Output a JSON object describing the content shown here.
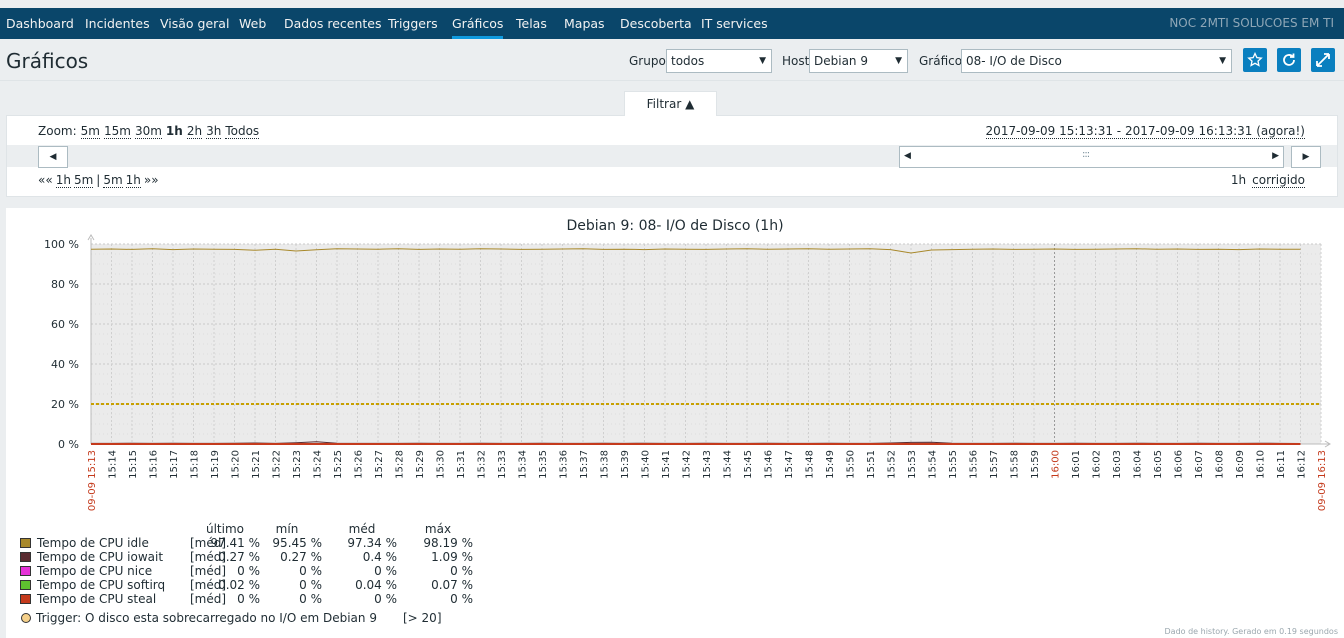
{
  "nav": {
    "items": [
      {
        "label": "Dashboard",
        "active": false
      },
      {
        "label": "Incidentes",
        "active": false
      },
      {
        "label": "Visão geral",
        "active": false
      },
      {
        "label": "Web",
        "active": false
      },
      {
        "label": "Dados recentes",
        "active": false
      },
      {
        "label": "Triggers",
        "active": false
      },
      {
        "label": "Gráficos",
        "active": true
      },
      {
        "label": "Telas",
        "active": false
      },
      {
        "label": "Mapas",
        "active": false
      },
      {
        "label": "Descoberta",
        "active": false
      },
      {
        "label": "IT services",
        "active": false
      }
    ],
    "brand": "NOC 2MTI SOLUCOES EM TI"
  },
  "header": {
    "title": "Gráficos",
    "group_label": "Grupo",
    "group_value": "todos",
    "host_label": "Host",
    "host_value": "Debian 9",
    "graph_label": "Gráfico",
    "graph_value": "08- I/O de Disco",
    "icons": [
      "star-icon",
      "refresh-icon",
      "fullscreen-icon"
    ]
  },
  "filter": {
    "tab_label": "Filtrar ▲",
    "zoom_label": "Zoom:",
    "zoom_options": [
      "5m",
      "15m",
      "30m",
      "1h",
      "2h",
      "3h",
      "Todos"
    ],
    "zoom_selected": "1h",
    "period": "2017-09-09 15:13:31 - 2017-09-09 16:13:31 (agora!)",
    "nav_back_all": "««",
    "nav_back": [
      "1h",
      "5m"
    ],
    "nav_separator": "|",
    "nav_fwd": [
      "5m",
      "1h"
    ],
    "nav_fwd_all": "»»",
    "period_length": "1h",
    "fixed_label": "corrigido",
    "slider_grip": ":::"
  },
  "chart_data": {
    "type": "line",
    "title": "Debian 9: 08- I/O de Disco (1h)",
    "y_ticks": [
      "100 %",
      "80 %",
      "60 %",
      "40 %",
      "20 %",
      "0 %"
    ],
    "ylim": [
      0,
      100
    ],
    "x_start_label": "09-09 15:13",
    "x_end_label": "09-09 16:13",
    "x_ticks": [
      "15:14",
      "15:15",
      "15:16",
      "15:17",
      "15:18",
      "15:19",
      "15:20",
      "15:21",
      "15:22",
      "15:23",
      "15:24",
      "15:25",
      "15:26",
      "15:27",
      "15:28",
      "15:29",
      "15:30",
      "15:31",
      "15:32",
      "15:33",
      "15:34",
      "15:35",
      "15:36",
      "15:37",
      "15:38",
      "15:39",
      "15:40",
      "15:41",
      "15:42",
      "15:43",
      "15:44",
      "15:45",
      "15:46",
      "15:47",
      "15:48",
      "15:49",
      "15:50",
      "15:51",
      "15:52",
      "15:53",
      "15:54",
      "15:55",
      "15:56",
      "15:57",
      "15:58",
      "15:59",
      "16:00",
      "16:01",
      "16:02",
      "16:03",
      "16:04",
      "16:05",
      "16:06",
      "16:07",
      "16:08",
      "16:09",
      "16:10",
      "16:11",
      "16:12",
      "16:13"
    ],
    "highlight_tick": "16:00",
    "series": [
      {
        "name": "Tempo de CPU idle",
        "color": "#a8882a",
        "values": [
          97.4,
          97.5,
          97.3,
          97.6,
          97.2,
          97.5,
          97.4,
          97.3,
          96.9,
          97.4,
          96.5,
          97.1,
          97.6,
          97.5,
          97.4,
          97.6,
          97.3,
          97.5,
          97.4,
          97.6,
          97.5,
          97.3,
          97.4,
          97.5,
          97.6,
          97.3,
          97.4,
          97.2,
          97.5,
          97.4,
          97.3,
          97.5,
          97.6,
          97.4,
          97.5,
          97.6,
          97.4,
          97.5,
          97.6,
          97.2,
          95.5,
          97.0,
          97.2,
          97.4,
          97.5,
          97.3,
          97.4,
          97.5,
          97.3,
          97.4,
          97.5,
          97.6,
          97.4,
          97.5,
          97.3,
          97.4,
          97.2,
          97.5,
          97.4,
          97.41
        ]
      },
      {
        "name": "Tempo de CPU iowait",
        "color": "#5a2b30",
        "values": [
          0.3,
          0.3,
          0.4,
          0.3,
          0.4,
          0.3,
          0.3,
          0.4,
          0.5,
          0.3,
          0.6,
          1.09,
          0.4,
          0.3,
          0.3,
          0.3,
          0.4,
          0.3,
          0.3,
          0.4,
          0.3,
          0.3,
          0.4,
          0.3,
          0.3,
          0.4,
          0.3,
          0.4,
          0.3,
          0.3,
          0.4,
          0.3,
          0.3,
          0.4,
          0.3,
          0.3,
          0.4,
          0.3,
          0.3,
          0.5,
          0.8,
          0.9,
          0.4,
          0.3,
          0.3,
          0.4,
          0.3,
          0.3,
          0.4,
          0.3,
          0.3,
          0.4,
          0.3,
          0.3,
          0.4,
          0.3,
          0.3,
          0.4,
          0.3,
          0.27
        ]
      },
      {
        "name": "Tempo de CPU nice",
        "color": "#e632d8",
        "values": [
          0,
          0,
          0,
          0,
          0,
          0,
          0,
          0,
          0,
          0,
          0,
          0,
          0,
          0,
          0,
          0,
          0,
          0,
          0,
          0,
          0,
          0,
          0,
          0,
          0,
          0,
          0,
          0,
          0,
          0,
          0,
          0,
          0,
          0,
          0,
          0,
          0,
          0,
          0,
          0,
          0,
          0,
          0,
          0,
          0,
          0,
          0,
          0,
          0,
          0,
          0,
          0,
          0,
          0,
          0,
          0,
          0,
          0,
          0,
          0
        ]
      },
      {
        "name": "Tempo de CPU softirq",
        "color": "#5ec22f",
        "values": [
          0.03,
          0.04,
          0.05,
          0.04,
          0.03,
          0.05,
          0.04,
          0.04,
          0.05,
          0.04,
          0.06,
          0.07,
          0.04,
          0.03,
          0.04,
          0.05,
          0.04,
          0.04,
          0.03,
          0.05,
          0.04,
          0.04,
          0.05,
          0.04,
          0.03,
          0.04,
          0.05,
          0.04,
          0.04,
          0.03,
          0.05,
          0.04,
          0.04,
          0.05,
          0.04,
          0.03,
          0.04,
          0.05,
          0.04,
          0.04,
          0.06,
          0.05,
          0.04,
          0.04,
          0.03,
          0.05,
          0.04,
          0.04,
          0.05,
          0.04,
          0.03,
          0.04,
          0.05,
          0.04,
          0.04,
          0.03,
          0.05,
          0.04,
          0.04,
          0.02
        ]
      },
      {
        "name": "Tempo de CPU steal",
        "color": "#c43a1c",
        "values": [
          0,
          0,
          0,
          0,
          0,
          0,
          0,
          0,
          0,
          0,
          0,
          0,
          0,
          0,
          0,
          0,
          0,
          0,
          0,
          0,
          0,
          0,
          0,
          0,
          0,
          0,
          0,
          0,
          0,
          0,
          0,
          0,
          0,
          0,
          0,
          0,
          0,
          0,
          0,
          0,
          0,
          0,
          0,
          0,
          0,
          0,
          0,
          0,
          0,
          0,
          0,
          0,
          0,
          0,
          0,
          0,
          0,
          0,
          0,
          0
        ]
      }
    ],
    "trigger_value": 20,
    "trigger_color": "#c8a000",
    "grid": true
  },
  "legend": {
    "headers": [
      "último",
      "mín",
      "méd",
      "máx"
    ],
    "rows": [
      {
        "name": "Tempo de CPU idle",
        "color": "#a8882a",
        "fn": "[méd]",
        "vals": [
          "97.41 %",
          "95.45 %",
          "97.34 %",
          "98.19 %"
        ]
      },
      {
        "name": "Tempo de CPU iowait",
        "color": "#5a2b30",
        "fn": "[méd]",
        "vals": [
          "0.27 %",
          "0.27 %",
          "0.4 %",
          "1.09 %"
        ]
      },
      {
        "name": "Tempo de CPU nice",
        "color": "#e632d8",
        "fn": "[méd]",
        "vals": [
          "0 %",
          "0 %",
          "0 %",
          "0 %"
        ]
      },
      {
        "name": "Tempo de CPU softirq",
        "color": "#5ec22f",
        "fn": "[méd]",
        "vals": [
          "0.02 %",
          "0 %",
          "0.04 %",
          "0.07 %"
        ]
      },
      {
        "name": "Tempo de CPU steal",
        "color": "#c43a1c",
        "fn": "[méd]",
        "vals": [
          "0 %",
          "0 %",
          "0 %",
          "0 %"
        ]
      }
    ],
    "trigger_text": "Trigger: O disco esta sobrecarregado no I/O em Debian 9",
    "trigger_cond": "[> 20]"
  },
  "footer": "Dado de history. Gerado em 0.19 segundos"
}
